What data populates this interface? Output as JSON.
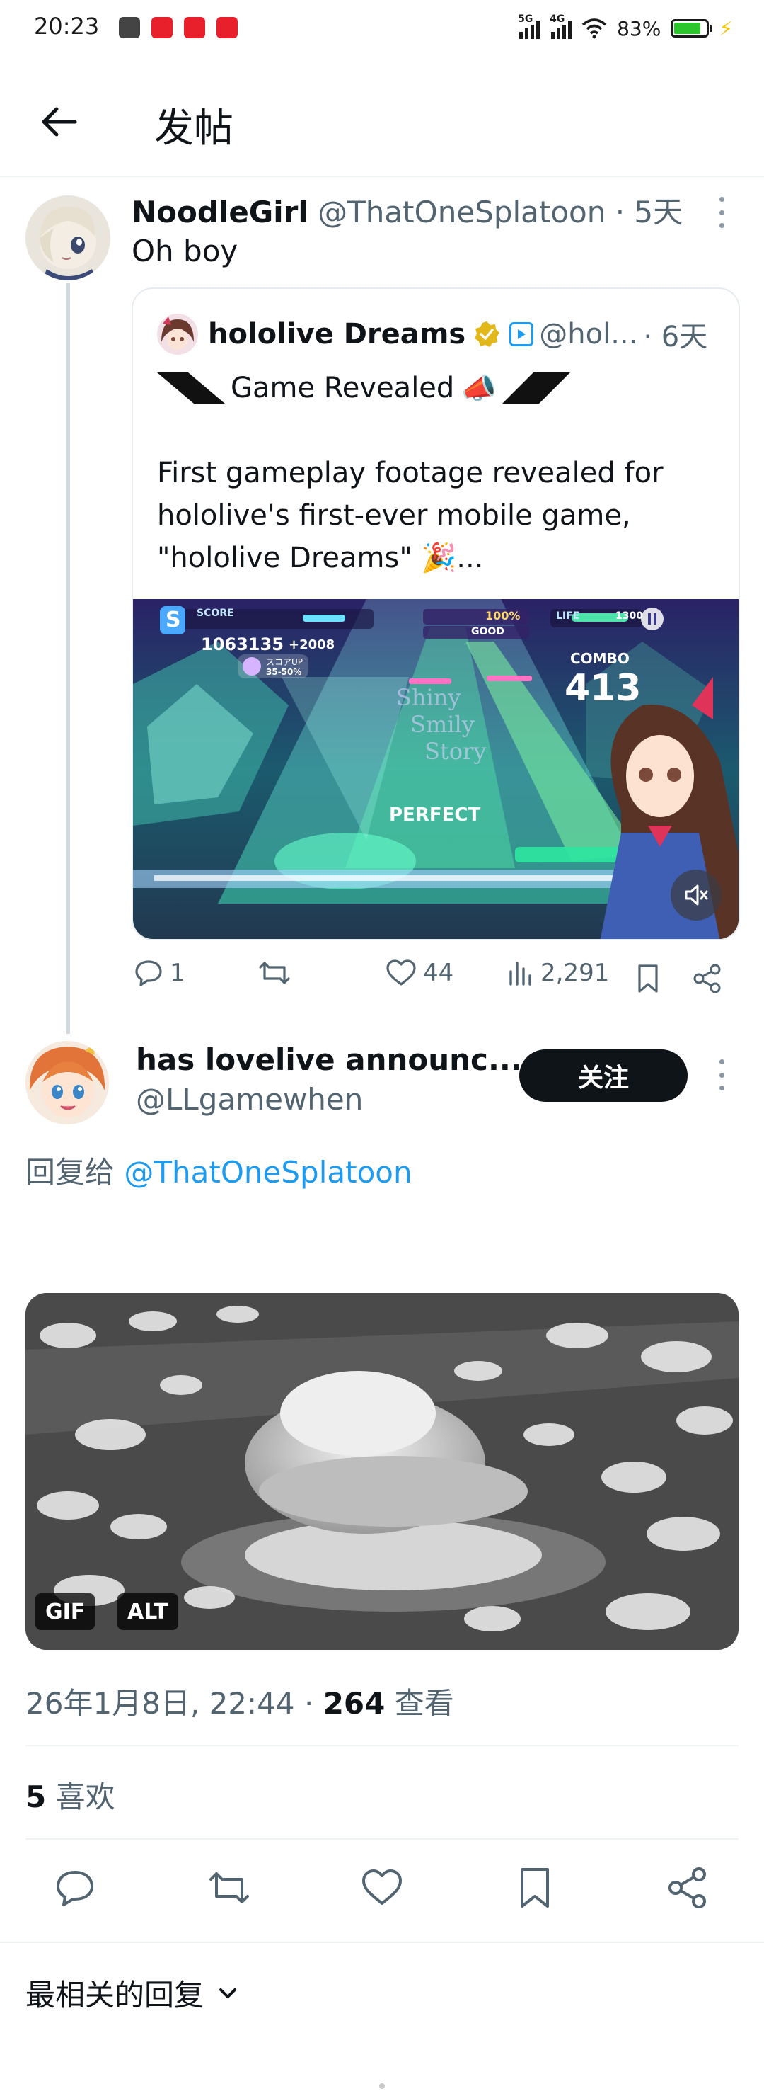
{
  "status_bar": {
    "time": "20:23",
    "net1": "5G",
    "net2": "4G",
    "battery": "83%",
    "battery_level": 0.83
  },
  "header": {
    "title": "发帖"
  },
  "tweet1": {
    "name": "NoodleGirl",
    "handle": "@ThatOneSplatoon",
    "time": "· 5天",
    "text": "Oh boy",
    "quote": {
      "name": "hololive Dreams",
      "handle": "@hol...",
      "time": "· 6天",
      "headline": "Game Revealed",
      "headline_emoji": "📣",
      "body_line1": "First gameplay footage revealed for",
      "body_line2": "hololive's first-ever mobile game,",
      "body_line3": "\"hololive Dreams\"",
      "body_emoji": "🎉",
      "body_ellipsis": "...",
      "game": {
        "score_label": "SCORE",
        "score": "1063135",
        "score_delta": "+2008",
        "combo_label": "COMBO",
        "combo": "413",
        "judge": "PERFECT",
        "life_label": "LIFE",
        "life_value": "1300",
        "good_label": "GOOD",
        "app_letter": "S",
        "bonus_label": "スコアUP",
        "bonus_value": "35-50%",
        "rate_value": "100%",
        "song_line1": "Shiny",
        "song_line2": "Smily",
        "song_line3": "Story"
      }
    },
    "actions": {
      "replies": "1",
      "likes": "44",
      "views": "2,291"
    }
  },
  "tweet2": {
    "name": "has lovelive announc...",
    "handle": "@LLgamewhen",
    "follow_label": "关注",
    "reply_prefix": "回复给",
    "reply_mention": "@ThatOneSplatoon",
    "media_badges": [
      "GIF",
      "ALT"
    ],
    "date": "26年1月8日, 22:44 · ",
    "views_count": "264",
    "views_label": " 查看",
    "likes_count": "5",
    "likes_label": " 喜欢"
  },
  "sort_label": "最相关的回复",
  "colors": {
    "accent": "#1d9bf0",
    "text": "#0f1419",
    "muted": "#536471",
    "gold": "#e2b719"
  }
}
